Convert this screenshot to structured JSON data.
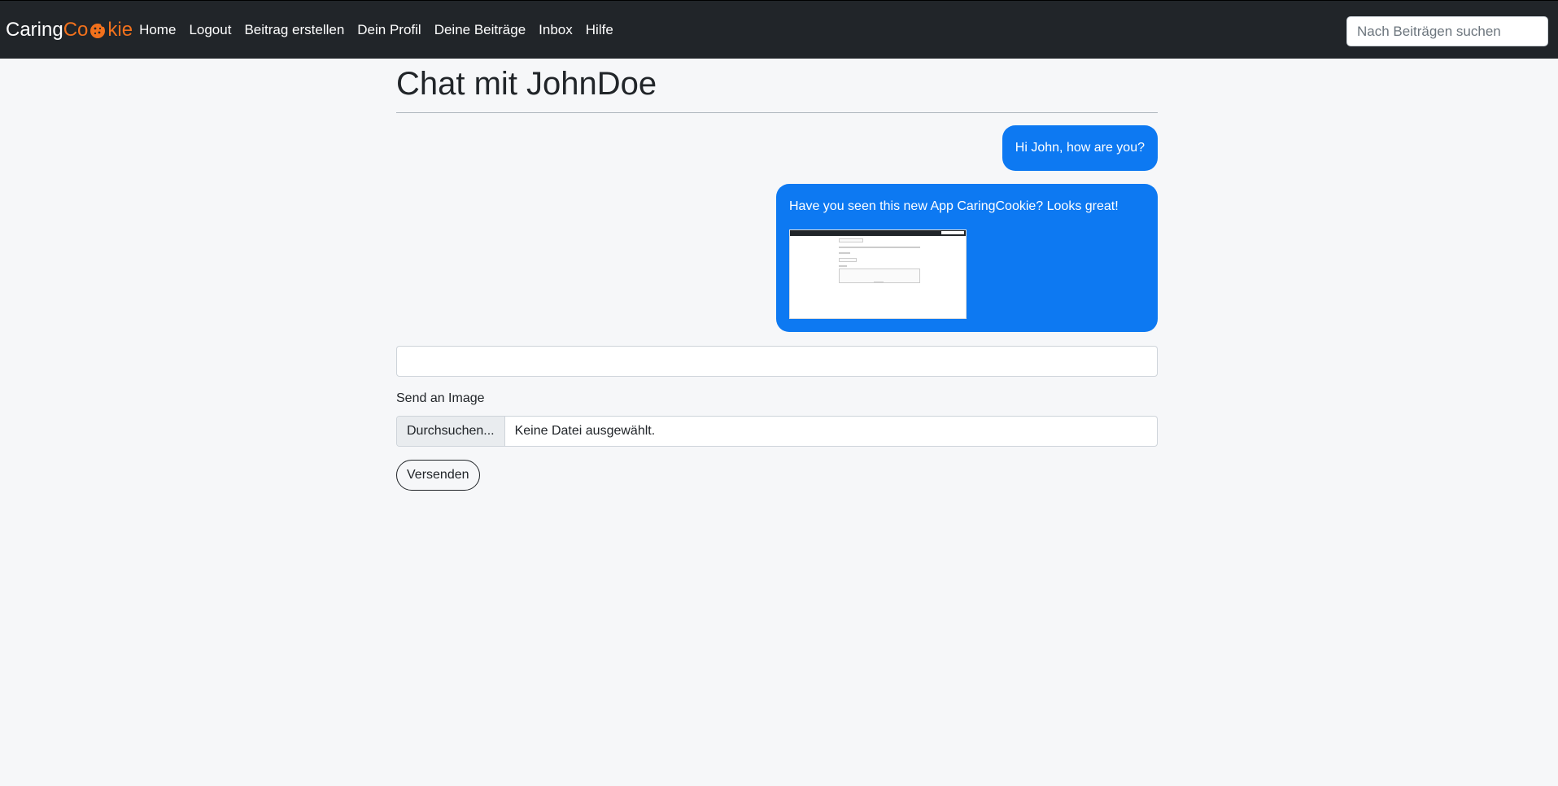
{
  "navbar": {
    "brand_part1": "Caring",
    "brand_part2": "Co",
    "brand_part3": "kie",
    "brand_icon": "cookie-icon",
    "links": [
      "Home",
      "Logout",
      "Beitrag erstellen",
      "Dein Profil",
      "Deine Beiträge",
      "Inbox",
      "Hilfe"
    ],
    "search_placeholder": "Nach Beiträgen suchen"
  },
  "chat": {
    "title": "Chat mit JohnDoe",
    "messages": [
      {
        "text": "Hi John, how are you?"
      },
      {
        "text": "Have you seen this new App CaringCookie? Looks great!",
        "has_image": true
      }
    ]
  },
  "form": {
    "message_value": "",
    "image_label": "Send an Image",
    "browse_label": "Durchsuchen...",
    "file_status": "Keine Datei ausgewählt.",
    "send_label": "Versenden"
  },
  "colors": {
    "navbar": "#212529",
    "brand_accent": "#f2711c",
    "bubble": "#0d79f2",
    "background": "#f6f7f9"
  }
}
